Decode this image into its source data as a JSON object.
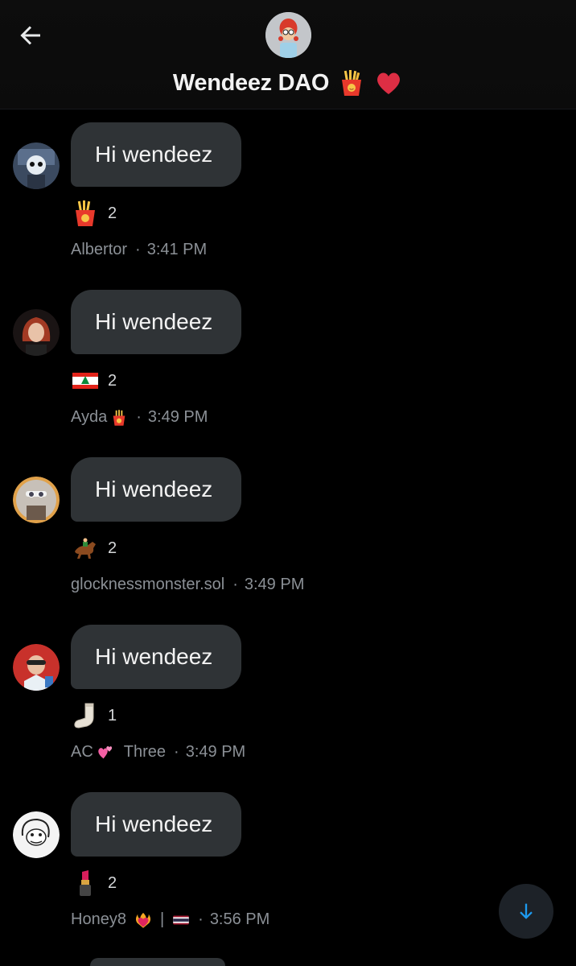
{
  "header": {
    "title": "Wendeez DAO",
    "back_icon": "arrow-left-icon",
    "title_emojis": [
      "fries-emoji",
      "red-heart-emoji"
    ]
  },
  "messages": [
    {
      "text": "Hi wendeez",
      "reaction_emoji": "fries-emoji",
      "reaction_count": "2",
      "sender": "Albertor",
      "sender_extra": "",
      "time": "3:41 PM"
    },
    {
      "text": "Hi wendeez",
      "reaction_emoji": "lebanon-flag-emoji",
      "reaction_count": "2",
      "sender": "Ayda",
      "sender_extra": "",
      "time": "3:49 PM"
    },
    {
      "text": "Hi wendeez",
      "reaction_emoji": "horse-emoji",
      "reaction_count": "2",
      "sender": "glocknessmonster.sol",
      "sender_extra": "",
      "time": "3:49 PM"
    },
    {
      "text": "Hi wendeez",
      "reaction_emoji": "socks-emoji",
      "reaction_count": "1",
      "sender": "AC",
      "sender_extra": "Three",
      "time": "3:49 PM"
    },
    {
      "text": "Hi wendeez",
      "reaction_emoji": "lipstick-emoji",
      "reaction_count": "2",
      "sender": "Honey8",
      "sender_extra": "|",
      "time": "3:56 PM"
    }
  ],
  "scroll_down_icon": "arrow-down-icon",
  "colors": {
    "background": "#000000",
    "bubble": "#2f3336",
    "accent": "#1d9bf0",
    "meta": "#8b9096"
  }
}
